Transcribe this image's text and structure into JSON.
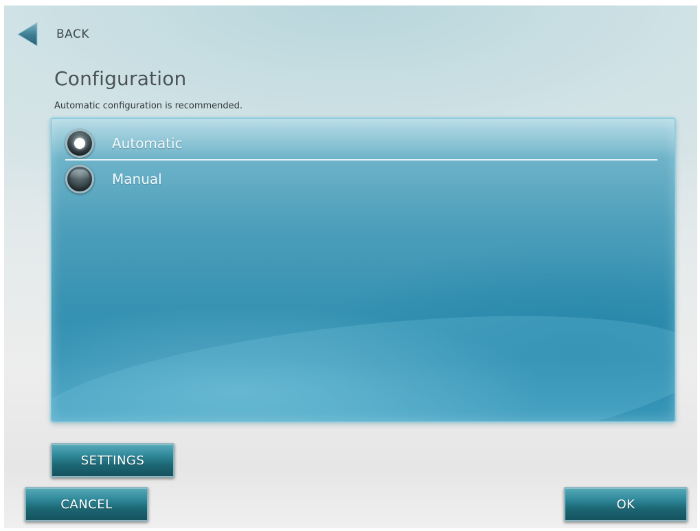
{
  "nav": {
    "back_label": "BACK"
  },
  "page": {
    "title": "Configuration",
    "subtitle": "Automatic configuration is recommended."
  },
  "options": [
    {
      "label": "Automatic",
      "selected": true
    },
    {
      "label": "Manual",
      "selected": false
    }
  ],
  "buttons": {
    "settings": "SETTINGS",
    "cancel": "CANCEL",
    "ok": "OK"
  },
  "colors": {
    "panel_accent": "#3893b2",
    "button_accent": "#2f8899",
    "text_dark": "#4a5257"
  },
  "icons": {
    "back": "back-arrow-icon"
  }
}
